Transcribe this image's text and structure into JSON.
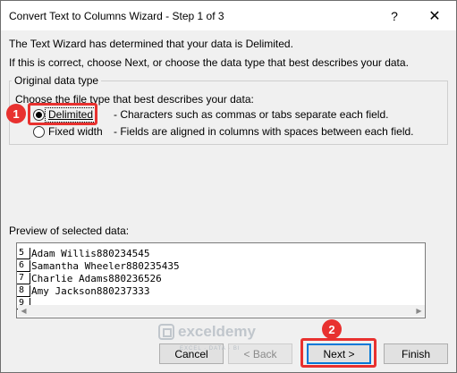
{
  "window": {
    "title": "Convert Text to Columns Wizard - Step 1 of 3",
    "help_label": "?",
    "close_label": "✕"
  },
  "intro": {
    "line1": "The Text Wizard has determined that your data is Delimited.",
    "line2": "If this is correct, choose Next, or choose the data type that best describes your data."
  },
  "original_data_type": {
    "title": "Original data type",
    "subtitle": "Choose the file type that best describes your data:",
    "options": [
      {
        "label": "Delimited",
        "description": "- Characters such as commas or tabs separate each field.",
        "selected": true
      },
      {
        "label": "Fixed width",
        "description": "- Fields are aligned in columns with spaces between each field.",
        "selected": false
      }
    ]
  },
  "preview": {
    "label": "Preview of selected data:",
    "row_numbers": [
      "5",
      "6",
      "7",
      "8",
      "9"
    ],
    "rows": [
      "Adam Willis880234545",
      "Samantha Wheeler880235435",
      "Charlie Adams880236526",
      "Amy Jackson880237333",
      ""
    ]
  },
  "watermark": {
    "name": "exceldemy",
    "tagline": "EXCEL · DATA · BI"
  },
  "buttons": {
    "cancel": "Cancel",
    "back": "< Back",
    "next": "Next >",
    "finish": "Finish"
  },
  "callouts": [
    "1",
    "2"
  ],
  "colors": {
    "callout": "#e8312f",
    "focus_blue": "#0078d7"
  }
}
